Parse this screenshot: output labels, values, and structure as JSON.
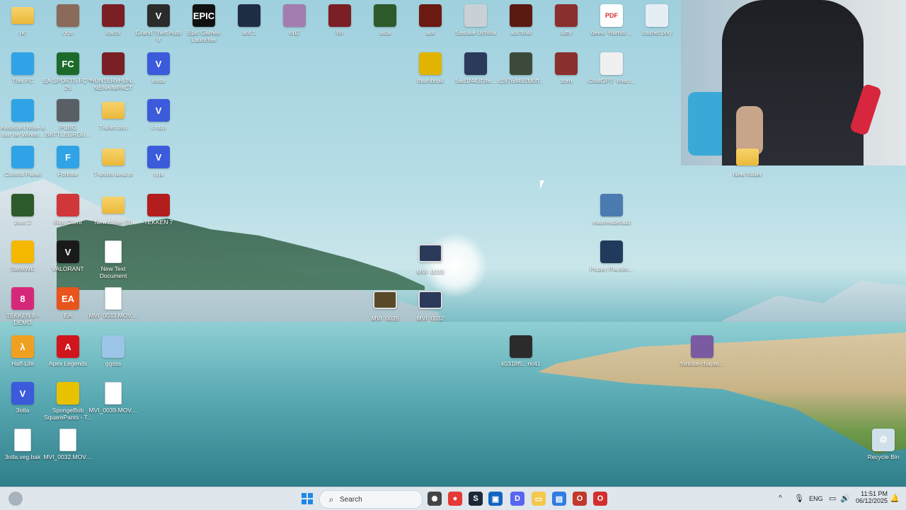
{
  "desktop": {
    "icons": [
      {
        "id": "pc",
        "label": "pc",
        "kind": "folder",
        "color": "#f2c94c",
        "glyph": ""
      },
      {
        "id": "ggs-top",
        "label": "ggs",
        "kind": "image",
        "color": "#8a6a5a",
        "glyph": ""
      },
      {
        "id": "itachi",
        "label": "itachi",
        "kind": "image",
        "color": "#7a1f24",
        "glyph": ""
      },
      {
        "id": "gta",
        "label": "Grand Theft Auto V",
        "kind": "app",
        "color": "#2b2b2b",
        "glyph": "V"
      },
      {
        "id": "epic",
        "label": "Epic Games Launcher",
        "kind": "app",
        "color": "#111111",
        "glyph": "EPIC"
      },
      {
        "id": "aot1",
        "label": "aot 1",
        "kind": "image",
        "color": "#1f2d44",
        "glyph": ""
      },
      {
        "id": "op2",
        "label": "op2",
        "kind": "image",
        "color": "#a37db0",
        "glyph": ""
      },
      {
        "id": "hh",
        "label": "hh",
        "kind": "image",
        "color": "#7a1f24",
        "glyph": ""
      },
      {
        "id": "asta",
        "label": "asta",
        "kind": "image",
        "color": "#2d5a2a",
        "glyph": ""
      },
      {
        "id": "aot",
        "label": "aot",
        "kind": "image",
        "color": "#6b1a12",
        "glyph": ""
      },
      {
        "id": "sasuke",
        "label": "Sasuke Uchiha",
        "kind": "image",
        "color": "#c9d0d6",
        "glyph": ""
      },
      {
        "id": "aotfinal",
        "label": "aot final",
        "kind": "image",
        "color": "#5a1a12",
        "glyph": ""
      },
      {
        "id": "luffy",
        "label": "luffy",
        "kind": "image",
        "color": "#8a2e2e",
        "glyph": ""
      },
      {
        "id": "pdf",
        "label": "devis_Hamdi ...",
        "kind": "pdf",
        "color": "#ffffff",
        "glyph": "PDF"
      },
      {
        "id": "cashet",
        "label": "cashet.png",
        "kind": "image",
        "color": "#e6eef5",
        "glyph": ""
      },
      {
        "id": "thispc",
        "label": "This PC",
        "kind": "app",
        "color": "#2fa3e6",
        "glyph": ""
      },
      {
        "id": "fc25",
        "label": "EA SPORTS FC™ 25",
        "kind": "app",
        "color": "#1d6b2b",
        "glyph": "FC"
      },
      {
        "id": "hunter",
        "label": "HUNTERxHUN... NEN×IMPACT",
        "kind": "app",
        "color": "#7a1f24",
        "glyph": ""
      },
      {
        "id": "insta",
        "label": "insta",
        "kind": "app",
        "color": "#3b5bdb",
        "glyph": "V"
      },
      {
        "id": "thumbnail",
        "label": "thumbnail",
        "kind": "image",
        "color": "#e0b400",
        "glyph": ""
      },
      {
        "id": "sad",
        "label": "5ad1f443f3fe...",
        "kind": "image",
        "color": "#2b3a5a",
        "glyph": ""
      },
      {
        "id": "c2876",
        "label": "c2876d492fd0ff...",
        "kind": "image",
        "color": "#3c4a3a",
        "glyph": ""
      },
      {
        "id": "zoro-top",
        "label": "zoro",
        "kind": "image",
        "color": "#8a2e2e",
        "glyph": ""
      },
      {
        "id": "chatgpt",
        "label": "ChatGPT_Imag...",
        "kind": "image",
        "color": "#f0f0f0",
        "glyph": ""
      },
      {
        "id": "assistant",
        "label": "Assistant Mise à jour de Windo...",
        "kind": "app",
        "color": "#2fa3e6",
        "glyph": ""
      },
      {
        "id": "pubg",
        "label": "PUBG BATTLEGROU...",
        "kind": "app",
        "color": "#5a5f66",
        "glyph": ""
      },
      {
        "id": "tshirtpng",
        "label": "T-shirt png",
        "kind": "folder",
        "color": "#f2c94c",
        "glyph": ""
      },
      {
        "id": "ccup",
        "label": "c cup",
        "kind": "app",
        "color": "#3b5bdb",
        "glyph": "V"
      },
      {
        "id": "controlpanel",
        "label": "Control Panel",
        "kind": "app",
        "color": "#2fa3e6",
        "glyph": ""
      },
      {
        "id": "fortnite",
        "label": "Fortnite",
        "kind": "app",
        "color": "#2fa3e6",
        "glyph": "F"
      },
      {
        "id": "tshirtsdesign",
        "label": "T-shirts design",
        "kind": "folder",
        "color": "#f2c94c",
        "glyph": ""
      },
      {
        "id": "ggs-app",
        "label": "ggs",
        "kind": "app",
        "color": "#3b5bdb",
        "glyph": "V"
      },
      {
        "id": "zoro2",
        "label": "zoro 2",
        "kind": "image",
        "color": "#2d5a2a",
        "glyph": ""
      },
      {
        "id": "riot",
        "label": "Riot Client",
        "kind": "app",
        "color": "#d13639",
        "glyph": ""
      },
      {
        "id": "newfolder3",
        "label": "New folder (3)",
        "kind": "folder",
        "color": "#f2c94c",
        "glyph": ""
      },
      {
        "id": "tekken7",
        "label": "TEKKEN 7",
        "kind": "app",
        "color": "#b31d1d",
        "glyph": ""
      },
      {
        "id": "smmwe",
        "label": "SMMWE",
        "kind": "app",
        "color": "#f5b800",
        "glyph": ""
      },
      {
        "id": "valorant",
        "label": "VALORANT",
        "kind": "app",
        "color": "#1a1a1a",
        "glyph": "V"
      },
      {
        "id": "newtext",
        "label": "New Text Document",
        "kind": "doc",
        "color": "#ffffff",
        "glyph": ""
      },
      {
        "id": "tekken8",
        "label": "TEKKEN 8 - DEMO",
        "kind": "app",
        "color": "#d6287a",
        "glyph": "8"
      },
      {
        "id": "ea",
        "label": "EA",
        "kind": "app",
        "color": "#e8541c",
        "glyph": "EA"
      },
      {
        "id": "mvi0033mov",
        "label": "MVI_0033.MOV....",
        "kind": "doc",
        "color": "#ffffff",
        "glyph": ""
      },
      {
        "id": "halflife",
        "label": "Half-Life",
        "kind": "app",
        "color": "#f0a020",
        "glyph": "λ"
      },
      {
        "id": "apex",
        "label": "Apex Legends",
        "kind": "app",
        "color": "#d0161c",
        "glyph": "A"
      },
      {
        "id": "ggsss",
        "label": "ggsss",
        "kind": "image",
        "color": "#9bc4e6",
        "glyph": ""
      },
      {
        "id": "3otla",
        "label": "3otla",
        "kind": "app",
        "color": "#3b5bdb",
        "glyph": "V"
      },
      {
        "id": "spongebob",
        "label": "SpongeBob SquarePants - T...",
        "kind": "app",
        "color": "#e8c200",
        "glyph": ""
      },
      {
        "id": "mvi0039mov",
        "label": "MVI_0039.MOV....",
        "kind": "doc",
        "color": "#ffffff",
        "glyph": ""
      },
      {
        "id": "3otlabak",
        "label": "3otla.veg.bak",
        "kind": "doc",
        "color": "#ffffff",
        "glyph": ""
      },
      {
        "id": "mvi0032mov",
        "label": "MVI_0032.MOV....",
        "kind": "doc",
        "color": "#ffffff",
        "glyph": ""
      },
      {
        "id": "mvi0033",
        "label": "MVI_0033",
        "kind": "video",
        "color": "#2b3a5a",
        "glyph": ""
      },
      {
        "id": "mvi0039",
        "label": "MVI_0039",
        "kind": "video",
        "color": "#5a4a2a",
        "glyph": ""
      },
      {
        "id": "mvi0032",
        "label": "MVI_0032",
        "kind": "video",
        "color": "#2b3a5a",
        "glyph": ""
      },
      {
        "id": "k0318",
        "label": "k0318f5...nc41",
        "kind": "image",
        "color": "#2b2b2b",
        "glyph": ""
      },
      {
        "id": "maxresdefault",
        "label": "maxresdefault",
        "kind": "image",
        "color": "#4a7ab0",
        "glyph": ""
      },
      {
        "id": "poppy",
        "label": "Poppy Playtim...",
        "kind": "image",
        "color": "#1f3a5a",
        "glyph": ""
      },
      {
        "id": "fortnitechapter",
        "label": "fortnite-chapte...",
        "kind": "image",
        "color": "#7a5aa0",
        "glyph": ""
      },
      {
        "id": "newfolder",
        "label": "New folder",
        "kind": "folder",
        "color": "#f2c94c",
        "glyph": ""
      },
      {
        "id": "recyclebin",
        "label": "Recycle Bin",
        "kind": "app",
        "color": "#cfe0ea",
        "glyph": "♲"
      }
    ]
  },
  "taskbar": {
    "search_placeholder": "Search",
    "language": "ENG",
    "time": "11:51 PM",
    "date": "06/12/2025",
    "icons": [
      {
        "name": "windows-start-icon",
        "color": "#1e88e5",
        "glyph": ""
      },
      {
        "name": "chatgpt-icon",
        "color": "#444444",
        "glyph": "✺"
      },
      {
        "name": "chrome-icon",
        "color": "#e53935",
        "glyph": "●"
      },
      {
        "name": "steam-icon",
        "color": "#1b2838",
        "glyph": "S"
      },
      {
        "name": "capture-icon",
        "color": "#1565c0",
        "glyph": "▣"
      },
      {
        "name": "discord-icon",
        "color": "#5865f2",
        "glyph": "D"
      },
      {
        "name": "file-explorer-icon",
        "color": "#f2c94c",
        "glyph": "▭"
      },
      {
        "name": "store-icon",
        "color": "#2f7de1",
        "glyph": "▤"
      },
      {
        "name": "opera-gx-icon",
        "color": "#c0392b",
        "glyph": "O"
      },
      {
        "name": "opera-icon",
        "color": "#d32f2f",
        "glyph": "O"
      }
    ]
  }
}
